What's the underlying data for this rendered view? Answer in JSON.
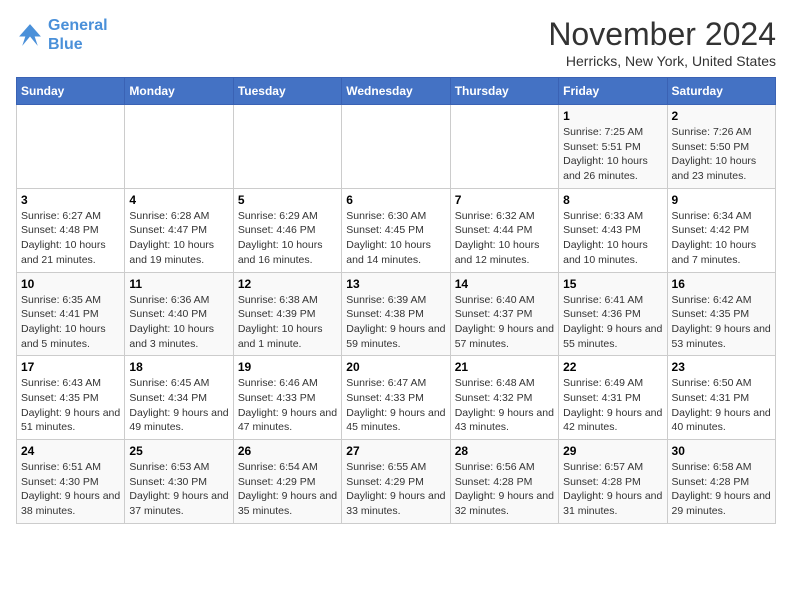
{
  "logo": {
    "line1": "General",
    "line2": "Blue"
  },
  "title": "November 2024",
  "location": "Herricks, New York, United States",
  "days_of_week": [
    "Sunday",
    "Monday",
    "Tuesday",
    "Wednesday",
    "Thursday",
    "Friday",
    "Saturday"
  ],
  "weeks": [
    [
      {
        "day": "",
        "info": ""
      },
      {
        "day": "",
        "info": ""
      },
      {
        "day": "",
        "info": ""
      },
      {
        "day": "",
        "info": ""
      },
      {
        "day": "",
        "info": ""
      },
      {
        "day": "1",
        "info": "Sunrise: 7:25 AM\nSunset: 5:51 PM\nDaylight: 10 hours and 26 minutes."
      },
      {
        "day": "2",
        "info": "Sunrise: 7:26 AM\nSunset: 5:50 PM\nDaylight: 10 hours and 23 minutes."
      }
    ],
    [
      {
        "day": "3",
        "info": "Sunrise: 6:27 AM\nSunset: 4:48 PM\nDaylight: 10 hours and 21 minutes."
      },
      {
        "day": "4",
        "info": "Sunrise: 6:28 AM\nSunset: 4:47 PM\nDaylight: 10 hours and 19 minutes."
      },
      {
        "day": "5",
        "info": "Sunrise: 6:29 AM\nSunset: 4:46 PM\nDaylight: 10 hours and 16 minutes."
      },
      {
        "day": "6",
        "info": "Sunrise: 6:30 AM\nSunset: 4:45 PM\nDaylight: 10 hours and 14 minutes."
      },
      {
        "day": "7",
        "info": "Sunrise: 6:32 AM\nSunset: 4:44 PM\nDaylight: 10 hours and 12 minutes."
      },
      {
        "day": "8",
        "info": "Sunrise: 6:33 AM\nSunset: 4:43 PM\nDaylight: 10 hours and 10 minutes."
      },
      {
        "day": "9",
        "info": "Sunrise: 6:34 AM\nSunset: 4:42 PM\nDaylight: 10 hours and 7 minutes."
      }
    ],
    [
      {
        "day": "10",
        "info": "Sunrise: 6:35 AM\nSunset: 4:41 PM\nDaylight: 10 hours and 5 minutes."
      },
      {
        "day": "11",
        "info": "Sunrise: 6:36 AM\nSunset: 4:40 PM\nDaylight: 10 hours and 3 minutes."
      },
      {
        "day": "12",
        "info": "Sunrise: 6:38 AM\nSunset: 4:39 PM\nDaylight: 10 hours and 1 minute."
      },
      {
        "day": "13",
        "info": "Sunrise: 6:39 AM\nSunset: 4:38 PM\nDaylight: 9 hours and 59 minutes."
      },
      {
        "day": "14",
        "info": "Sunrise: 6:40 AM\nSunset: 4:37 PM\nDaylight: 9 hours and 57 minutes."
      },
      {
        "day": "15",
        "info": "Sunrise: 6:41 AM\nSunset: 4:36 PM\nDaylight: 9 hours and 55 minutes."
      },
      {
        "day": "16",
        "info": "Sunrise: 6:42 AM\nSunset: 4:35 PM\nDaylight: 9 hours and 53 minutes."
      }
    ],
    [
      {
        "day": "17",
        "info": "Sunrise: 6:43 AM\nSunset: 4:35 PM\nDaylight: 9 hours and 51 minutes."
      },
      {
        "day": "18",
        "info": "Sunrise: 6:45 AM\nSunset: 4:34 PM\nDaylight: 9 hours and 49 minutes."
      },
      {
        "day": "19",
        "info": "Sunrise: 6:46 AM\nSunset: 4:33 PM\nDaylight: 9 hours and 47 minutes."
      },
      {
        "day": "20",
        "info": "Sunrise: 6:47 AM\nSunset: 4:33 PM\nDaylight: 9 hours and 45 minutes."
      },
      {
        "day": "21",
        "info": "Sunrise: 6:48 AM\nSunset: 4:32 PM\nDaylight: 9 hours and 43 minutes."
      },
      {
        "day": "22",
        "info": "Sunrise: 6:49 AM\nSunset: 4:31 PM\nDaylight: 9 hours and 42 minutes."
      },
      {
        "day": "23",
        "info": "Sunrise: 6:50 AM\nSunset: 4:31 PM\nDaylight: 9 hours and 40 minutes."
      }
    ],
    [
      {
        "day": "24",
        "info": "Sunrise: 6:51 AM\nSunset: 4:30 PM\nDaylight: 9 hours and 38 minutes."
      },
      {
        "day": "25",
        "info": "Sunrise: 6:53 AM\nSunset: 4:30 PM\nDaylight: 9 hours and 37 minutes."
      },
      {
        "day": "26",
        "info": "Sunrise: 6:54 AM\nSunset: 4:29 PM\nDaylight: 9 hours and 35 minutes."
      },
      {
        "day": "27",
        "info": "Sunrise: 6:55 AM\nSunset: 4:29 PM\nDaylight: 9 hours and 33 minutes."
      },
      {
        "day": "28",
        "info": "Sunrise: 6:56 AM\nSunset: 4:28 PM\nDaylight: 9 hours and 32 minutes."
      },
      {
        "day": "29",
        "info": "Sunrise: 6:57 AM\nSunset: 4:28 PM\nDaylight: 9 hours and 31 minutes."
      },
      {
        "day": "30",
        "info": "Sunrise: 6:58 AM\nSunset: 4:28 PM\nDaylight: 9 hours and 29 minutes."
      }
    ]
  ]
}
